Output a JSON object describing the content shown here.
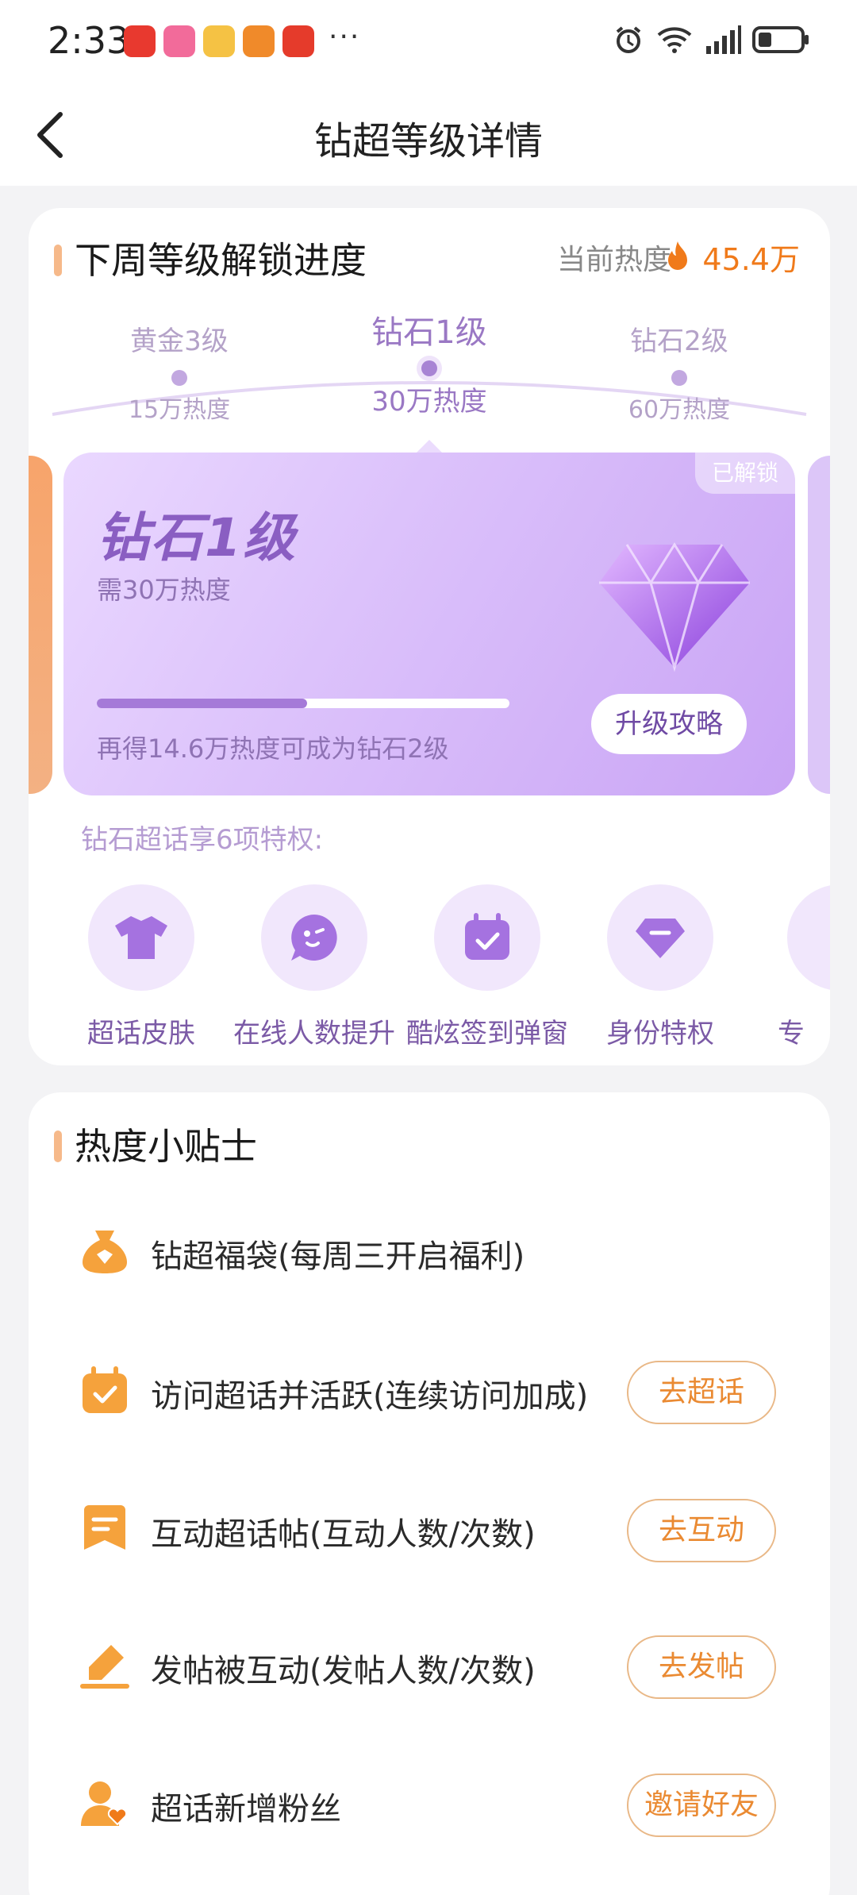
{
  "status_bar": {
    "time": "2:33",
    "dots": "···",
    "network": "6"
  },
  "header": {
    "title": "钻超等级详情"
  },
  "progress_section": {
    "title": "下周等级解锁进度",
    "current_heat_label": "当前热度",
    "current_heat_value": "45.4万",
    "levels": [
      {
        "name": "黄金3级",
        "heat": "15万热度"
      },
      {
        "name": "钻石1级",
        "heat": "30万热度"
      },
      {
        "name": "钻石2级",
        "heat": "60万热度"
      }
    ],
    "level_card": {
      "badge": "已解锁",
      "name": "钻石1级",
      "requirement": "需30万热度",
      "progress_fraction": 0.51,
      "tip": "再得14.6万热度可成为钻石2级",
      "button": "升级攻略"
    },
    "privileges_title": "钻石超话享6项特权:",
    "privileges": [
      {
        "label": "超话皮肤",
        "icon": "tshirt-icon"
      },
      {
        "label": "在线人数提升",
        "icon": "chat-smile-icon"
      },
      {
        "label": "酷炫签到弹窗",
        "icon": "calendar-check-icon"
      },
      {
        "label": "身份特权",
        "icon": "diamond-icon"
      },
      {
        "label": "专",
        "icon": "privilege-icon"
      }
    ]
  },
  "tips_section": {
    "title": "热度小贴士",
    "items": [
      {
        "text": "钻超福袋(每周三开启福利)",
        "button": "",
        "icon": "lucky-bag-icon"
      },
      {
        "text": "访问超话并活跃(连续访问加成)",
        "button": "去超话",
        "icon": "calendar-check-icon"
      },
      {
        "text": "互动超话帖(互动人数/次数)",
        "button": "去互动",
        "icon": "bookmark-icon"
      },
      {
        "text": "发帖被互动(发帖人数/次数)",
        "button": "去发帖",
        "icon": "pencil-icon"
      },
      {
        "text": "超话新增粉丝",
        "button": "邀请好友",
        "icon": "user-heart-icon"
      }
    ]
  },
  "colors": {
    "accent_orange": "#f07a1a",
    "accent_purple": "#8a5ec2"
  }
}
